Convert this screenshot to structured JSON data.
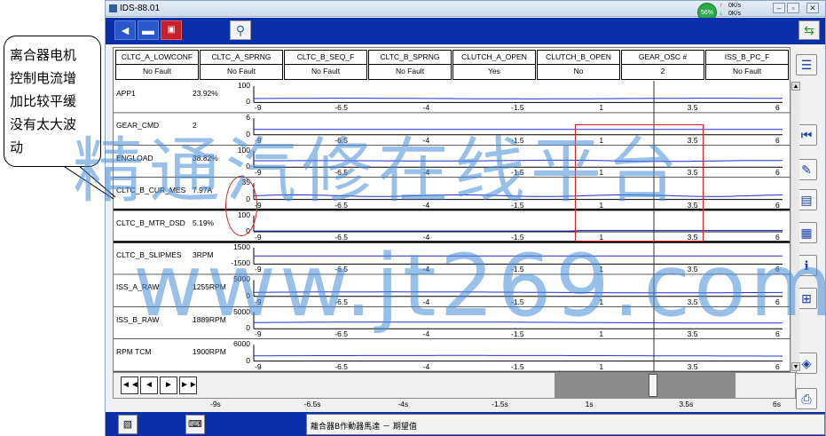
{
  "window": {
    "title": "IDS-88.01",
    "net_percent": "56%",
    "net_up_rate": "0K/s",
    "net_down_rate": "0K/s"
  },
  "annotation": {
    "lines": [
      "离合器电机",
      "控制电流增",
      "加比较平缓",
      "没有太大波",
      "动"
    ]
  },
  "pid_table": [
    {
      "name": "CLTC_A_LOWCONF",
      "value": "No Fault"
    },
    {
      "name": "CLTC_A_SPRNG",
      "value": "No Fault"
    },
    {
      "name": "CLTC_B_SEQ_F",
      "value": "No Fault"
    },
    {
      "name": "CLTC_B_SPRNG",
      "value": "No Fault"
    },
    {
      "name": "CLUTCH_A_OPEN",
      "value": "Yes"
    },
    {
      "name": "CLUTCH_B_OPEN",
      "value": "No"
    },
    {
      "name": "GEAR_OSC #",
      "value": "2"
    },
    {
      "name": "ISS_B_PC_F",
      "value": "No Fault"
    }
  ],
  "graph_rows": [
    {
      "name": "APP1",
      "value": "23.92%",
      "ymax": "100",
      "ymin": "0"
    },
    {
      "name": "GEAR_CMD",
      "value": "2",
      "ymax": "6",
      "ymin": "0"
    },
    {
      "name": "ENGLOAD",
      "value": "38.82%",
      "ymax": "100",
      "ymin": "0"
    },
    {
      "name": "CLTC_B_CUR_MES",
      "value": "7.97A",
      "ymax": "35",
      "ymin": "0"
    },
    {
      "name": "CLTC_B_MTR_DSD",
      "value": "5.19%",
      "ymax": "100",
      "ymin": "0"
    },
    {
      "name": "CLTC_B_SLIPMES",
      "value": "3RPM",
      "ymax": "1500",
      "ymin": "-1500"
    },
    {
      "name": "ISS_A_RAW",
      "value": "1255RPM",
      "ymax": "5000",
      "ymin": "0"
    },
    {
      "name": "ISS_B_RAW",
      "value": "1889RPM",
      "ymax": "5000",
      "ymin": "0"
    },
    {
      "name": "RPM TCM",
      "value": "1900RPM",
      "ymax": "6000",
      "ymin": "0"
    }
  ],
  "graph_xticks": [
    "-9",
    "-6.5",
    "-4",
    "-1.5",
    "1",
    "3.5",
    "6"
  ],
  "time_axis": [
    "-9s",
    "-6.5s",
    "-4s",
    "-1.5s",
    "1s",
    "3.5s",
    "6s"
  ],
  "playback": {
    "first_label": "◄◄",
    "prev_label": "◄",
    "next_label": "►",
    "last_label": "►►"
  },
  "status": {
    "text": "離合器B作動器馬達 － 期望值"
  },
  "watermark": {
    "line1": "精通汽修在线平台",
    "line2": "www.jt269.com"
  },
  "colors": {
    "toolbar_blue": "#0a2fa8",
    "trace_blue": "#2233cc",
    "highlight_red": "#e02020",
    "watermark_blue": "#468cd7"
  },
  "icons": [
    "back-arrow-icon",
    "car-icon",
    "toolbox-icon",
    "magnifier-icon",
    "swap-arrows-icon",
    "list-icon",
    "rewind-icon",
    "report-icon",
    "info-icon",
    "graph-icon"
  ]
}
